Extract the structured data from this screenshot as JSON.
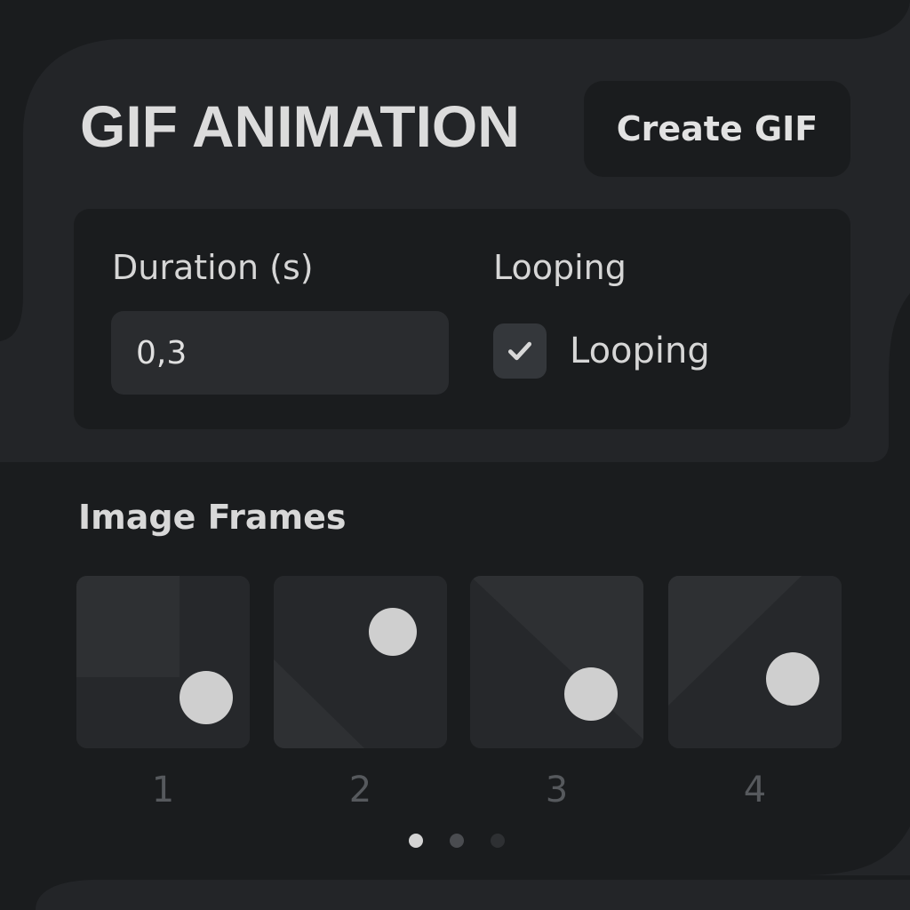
{
  "header": {
    "title": "GIF ANIMATION",
    "create_button_label": "Create GIF"
  },
  "settings": {
    "duration_label": "Duration (s)",
    "duration_value": "0,3",
    "looping_label": "Looping",
    "looping_checkbox_label": "Looping",
    "looping_checked": true
  },
  "frames": {
    "title": "Image Frames",
    "items": [
      {
        "number": "1"
      },
      {
        "number": "2"
      },
      {
        "number": "3"
      },
      {
        "number": "4"
      }
    ]
  },
  "pagination": {
    "pages": 3,
    "active_index": 0
  },
  "colors": {
    "background": "#1a1c1e",
    "panel": "#232528",
    "frame_bg": "#2a2c2f",
    "text": "#dcdcdc",
    "ball": "#cfcfcf"
  },
  "icons": {
    "checkbox": "checkmark-icon"
  }
}
